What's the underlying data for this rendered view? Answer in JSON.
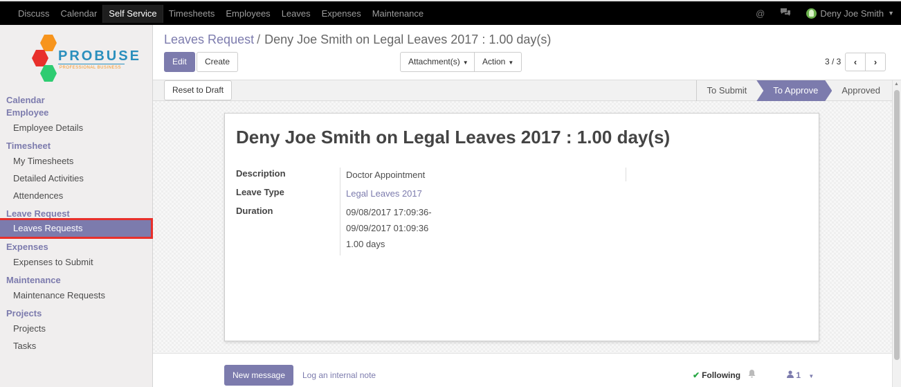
{
  "topbar": {
    "menu": [
      "Discuss",
      "Calendar",
      "Self Service",
      "Timesheets",
      "Employees",
      "Leaves",
      "Expenses",
      "Maintenance"
    ],
    "active_index": 2,
    "user_name": "Deny Joe Smith"
  },
  "logo": {
    "name": "PROBUSE",
    "tagline": "PROFESSIONAL BUSINESS"
  },
  "sidebar": {
    "sections": [
      {
        "title": "Calendar",
        "items": []
      },
      {
        "title": "Employee",
        "items": [
          "Employee Details"
        ]
      },
      {
        "title": "Timesheet",
        "items": [
          "My Timesheets",
          "Detailed Activities",
          "Attendences"
        ]
      },
      {
        "title": "Leave Request",
        "items": [
          "Leaves Requests"
        ]
      },
      {
        "title": "Expenses",
        "items": [
          "Expenses to Submit"
        ]
      },
      {
        "title": "Maintenance",
        "items": [
          "Maintenance Requests"
        ]
      },
      {
        "title": "Projects",
        "items": [
          "Projects",
          "Tasks"
        ]
      }
    ]
  },
  "breadcrumb": {
    "parent": "Leaves Request",
    "separator": "/",
    "current": "Deny Joe Smith on Legal Leaves 2017 : 1.00 day(s)"
  },
  "buttons": {
    "edit": "Edit",
    "create": "Create",
    "attachments": "Attachment(s)",
    "action": "Action",
    "reset_to_draft": "Reset to Draft",
    "new_message": "New message"
  },
  "pager": {
    "value": "3 / 3"
  },
  "statusbar": {
    "stages": [
      "To Submit",
      "To Approve",
      "Approved"
    ],
    "current": "To Approve"
  },
  "record": {
    "title": "Deny Joe Smith on Legal Leaves 2017 : 1.00 day(s)",
    "labels": {
      "description": "Description",
      "leave_type": "Leave Type",
      "duration": "Duration"
    },
    "description": "Doctor Appointment",
    "leave_type": "Legal Leaves 2017",
    "duration_from": "09/08/2017 17:09:36-",
    "duration_to": "09/09/2017 01:09:36",
    "duration_days": "1.00 days"
  },
  "chatter": {
    "log_note": "Log an internal note",
    "following": "Following",
    "followers_count": "1"
  },
  "colors": {
    "accent": "#7c7bad",
    "highlight_border": "#e8302b",
    "topbar": "#000000"
  }
}
